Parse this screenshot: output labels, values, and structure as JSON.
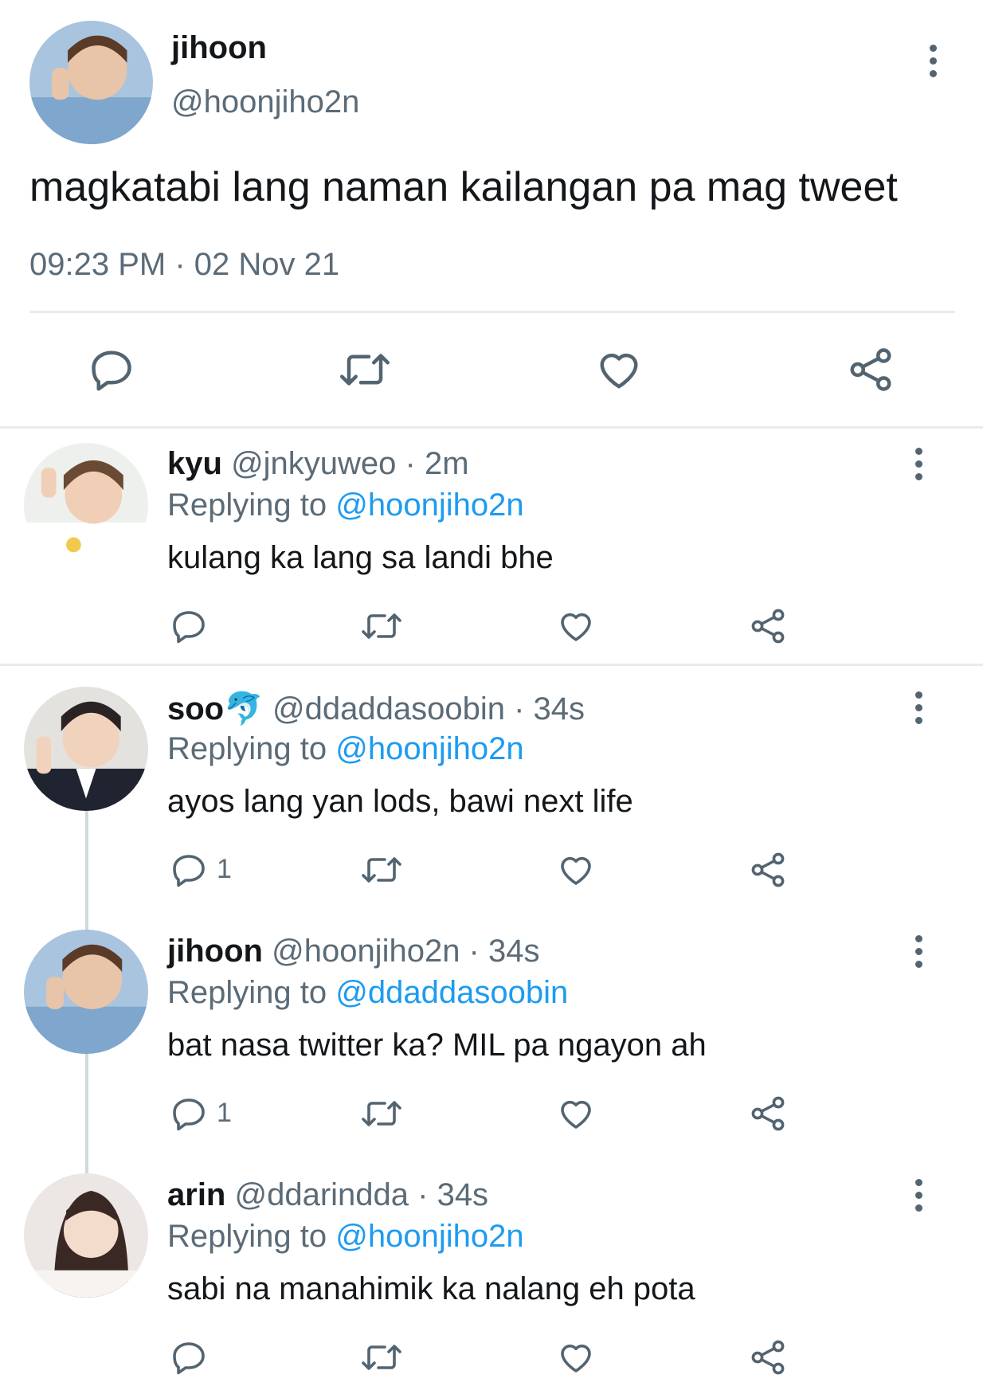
{
  "main_tweet": {
    "name": "jihoon",
    "handle": "@hoonjiho2n",
    "text": "magkatabi lang naman kailangan pa mag tweet",
    "timestamp": "09:23 PM · 02 Nov 21"
  },
  "replies": [
    {
      "name": "kyu",
      "meta": "@jnkyuweo · 2m",
      "replying_label": "Replying to",
      "replying_to": "@hoonjiho2n",
      "text": "kulang ka lang sa landi bhe",
      "reply_count": ""
    },
    {
      "name": "soo🐬",
      "meta": "@ddaddasoobin · 34s",
      "replying_label": "Replying to",
      "replying_to": "@hoonjiho2n",
      "text": "ayos lang yan lods, bawi next life",
      "reply_count": "1"
    },
    {
      "name": "jihoon",
      "meta": "@hoonjiho2n · 34s",
      "replying_label": "Replying to",
      "replying_to": "@ddaddasoobin",
      "text": "bat nasa twitter ka? MIL pa ngayon ah",
      "reply_count": "1"
    },
    {
      "name": "arin",
      "meta": "@ddarindda · 34s",
      "replying_label": "Replying to",
      "replying_to": "@hoonjiho2n",
      "text": "sabi na manahimik ka nalang eh pota",
      "reply_count": ""
    }
  ],
  "colors": {
    "accent": "#1d9bf0",
    "icon": "#536471",
    "divider": "#e6ecf0"
  },
  "icons": [
    "reply-icon",
    "retweet-icon",
    "like-icon",
    "share-icon",
    "more-icon"
  ]
}
